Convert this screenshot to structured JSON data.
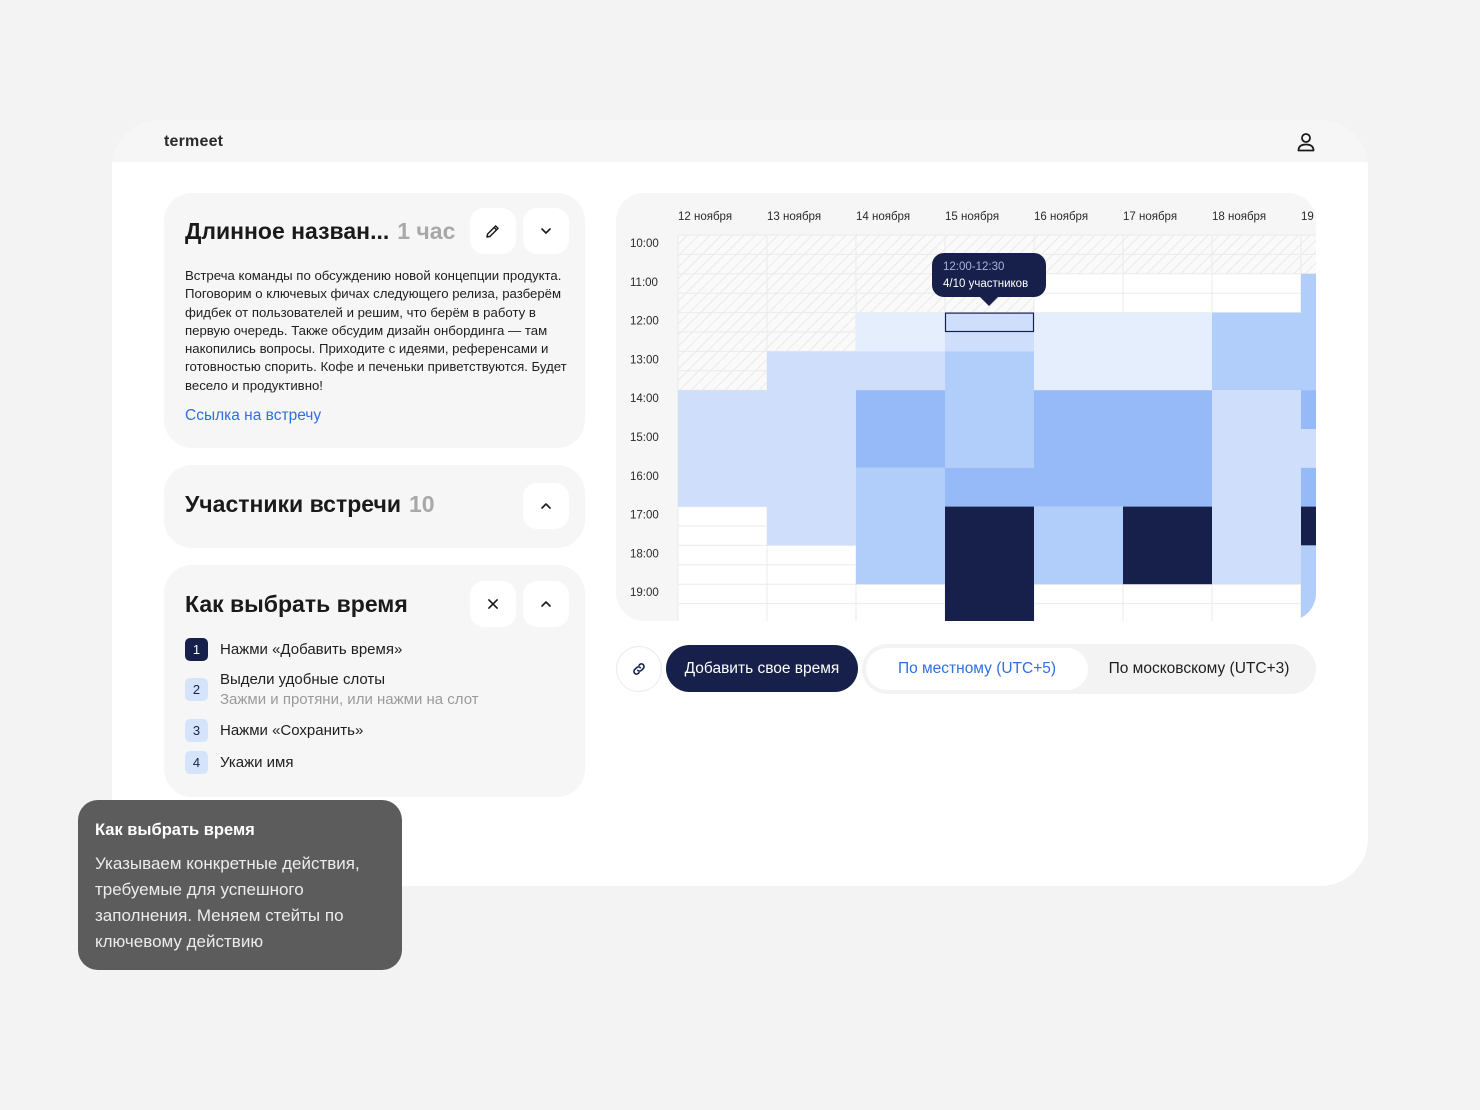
{
  "app": {
    "logo": "termeet"
  },
  "meeting_card": {
    "title": "Длинное назван...",
    "duration": "1 час",
    "description": "Встреча команды по обсуждению новой концепции продукта. Поговорим о ключевых фичах следующего релиза, разберём фидбек от пользователей и решим, что берём в работу в первую очередь. Также обсудим дизайн онбординга — там накопились вопросы. Приходите с идеями, референсами и готовностью спорить. Кофе и печеньки приветствуются. Будет весело и продуктивно!",
    "link_label": "Ссылка на встречу"
  },
  "participants_card": {
    "title": "Участники встречи",
    "count": "10"
  },
  "howto_card": {
    "title": "Как выбрать время",
    "steps": [
      {
        "num": "1",
        "label": "Нажми «Добавить время»",
        "sub": ""
      },
      {
        "num": "2",
        "label": "Выдели удобные слоты",
        "sub": "Зажми и протяни, или нажми на слот"
      },
      {
        "num": "3",
        "label": "Нажми «Сохранить»",
        "sub": ""
      },
      {
        "num": "4",
        "label": "Укажи имя",
        "sub": ""
      }
    ]
  },
  "calendar": {
    "days": [
      "12 ноября",
      "13 ноября",
      "14 ноября",
      "15 ноября",
      "16 ноября",
      "17 ноября",
      "18 ноября",
      "19"
    ],
    "times": [
      "10:00",
      "11:00",
      "12:00",
      "13:00",
      "14:00",
      "15:00",
      "16:00",
      "17:00",
      "18:00",
      "19:00"
    ],
    "tooltip": {
      "time": "12:00-12:30",
      "count": "4/10 участников"
    },
    "colors": {
      "l1": "#e5eefc",
      "l2": "#cfdffb",
      "l3": "#b1cdfa",
      "l4": "#96b9f7",
      "l5": "#17204a"
    }
  },
  "toolbar": {
    "add_label": "Добавить свое время",
    "tz_local": "По местному (UTC+5)",
    "tz_moscow": "По московскому (UTC+3)"
  },
  "note": {
    "title": "Как выбрать время",
    "body": "Указываем конкретные действия, требуемые для успешного заполнения. Меняем стейты по ключевому действию"
  }
}
